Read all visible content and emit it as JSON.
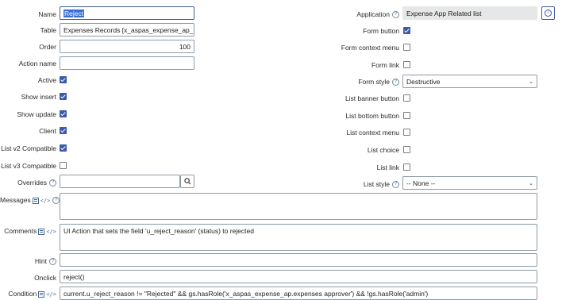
{
  "left": {
    "name": {
      "label": "Name",
      "value": "Reject"
    },
    "table": {
      "label": "Table",
      "value": "Expenses Records [x_aspas_expense_ap_ex..."
    },
    "order": {
      "label": "Order",
      "value": "100"
    },
    "action_name": {
      "label": "Action name",
      "value": ""
    },
    "active": {
      "label": "Active",
      "checked": true
    },
    "show_insert": {
      "label": "Show insert",
      "checked": true
    },
    "show_update": {
      "label": "Show update",
      "checked": true
    },
    "client": {
      "label": "Client",
      "checked": true
    },
    "list_v2": {
      "label": "List v2 Compatible",
      "checked": true
    },
    "list_v3": {
      "label": "List v3 Compatible",
      "checked": false
    },
    "overrides": {
      "label": "Overrides",
      "value": ""
    }
  },
  "right": {
    "application": {
      "label": "Application",
      "value": "Expense App Related list"
    },
    "form_button": {
      "label": "Form button",
      "checked": true
    },
    "form_context_menu": {
      "label": "Form context menu",
      "checked": false
    },
    "form_link": {
      "label": "Form link",
      "checked": false
    },
    "form_style": {
      "label": "Form style",
      "value": "Destructive"
    },
    "list_banner_button": {
      "label": "List banner button",
      "checked": false
    },
    "list_bottom_button": {
      "label": "List bottom button",
      "checked": false
    },
    "list_context_menu": {
      "label": "List context menu",
      "checked": false
    },
    "list_choice": {
      "label": "List choice",
      "checked": false
    },
    "list_link": {
      "label": "List link",
      "checked": false
    },
    "list_style": {
      "label": "List style",
      "value": "-- None --"
    }
  },
  "wide": {
    "messages": {
      "label": "Messages",
      "value": ""
    },
    "comments": {
      "label": "Comments",
      "value": "UI Action that sets the field 'u_reject_reason' (status) to rejected"
    },
    "hint": {
      "label": "Hint",
      "value": ""
    },
    "onclick": {
      "label": "Onclick",
      "value": "reject()"
    },
    "condition": {
      "label": "Condition",
      "value": "current.u_reject_reason != \"Rejected\" && gs.hasRole('x_aspas_expense_ap.expenses approver') && !gs.hasRole('admin')"
    }
  },
  "icons": {
    "help": "?",
    "info": "i",
    "search": "search-icon",
    "dropdown": "chevron-down-icon"
  },
  "colors": {
    "accent": "#3b5aa7",
    "readonly_bg": "#e6e7e8",
    "border": "#8f9ba6"
  }
}
